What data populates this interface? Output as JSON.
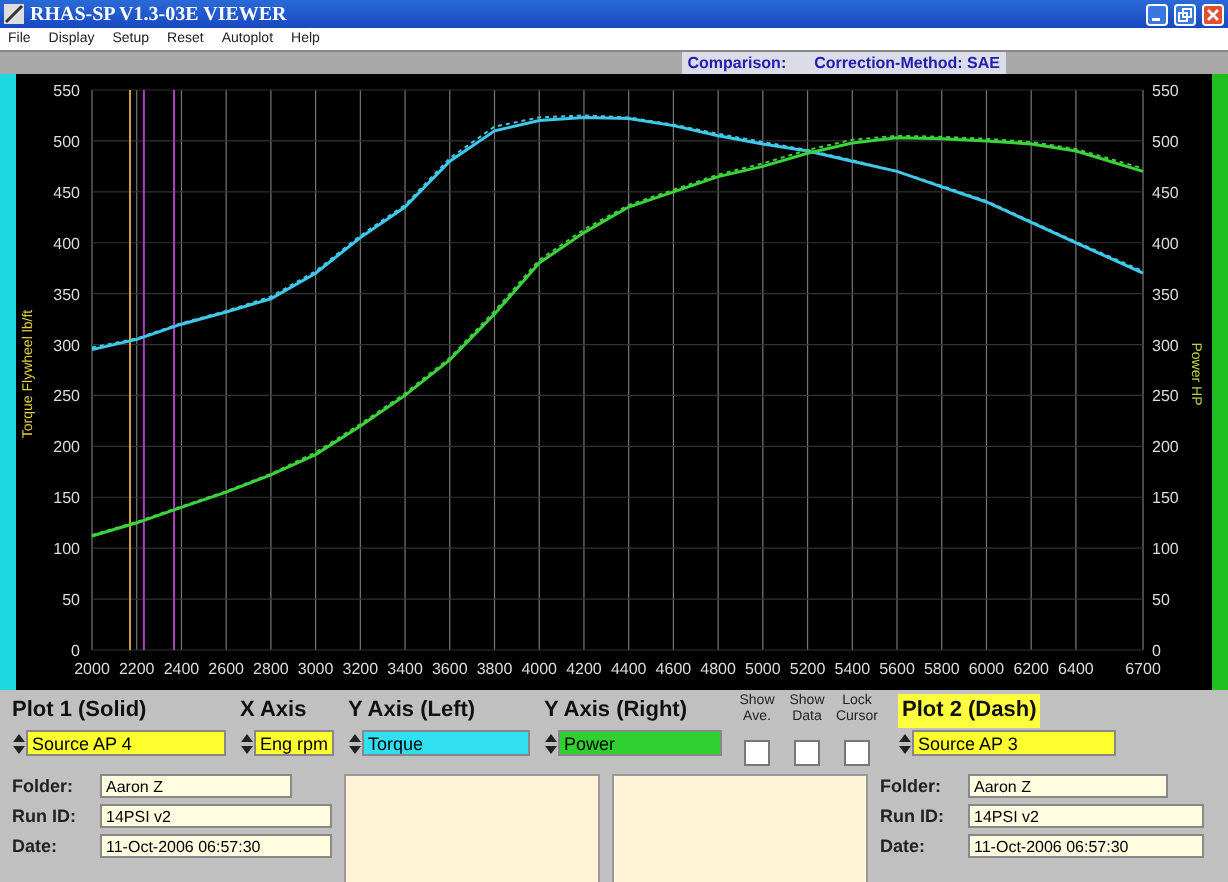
{
  "window": {
    "title": "RHAS-SP V1.3-03E VIEWER"
  },
  "menu": [
    "File",
    "Display",
    "Setup",
    "Reset",
    "Autoplot",
    "Help"
  ],
  "header": {
    "label": "Comparison:",
    "value": "Correction-Method: SAE"
  },
  "chart": {
    "left_axis": {
      "ticks": [
        "550",
        "500",
        "450",
        "400",
        "350",
        "300",
        "250",
        "200",
        "150",
        "100",
        "50",
        "0"
      ]
    },
    "right_axis": {
      "label": "Power HP"
    },
    "chart_data": {
      "type": "line",
      "ylabel": "Torque Flywheel lb/ft",
      "grid": true,
      "x": [
        2000,
        2200,
        2400,
        2600,
        2800,
        3000,
        3200,
        3400,
        3600,
        3800,
        4000,
        4200,
        4400,
        4600,
        4800,
        5000,
        5200,
        5400,
        5600,
        5800,
        6000,
        6200,
        6400,
        6700
      ],
      "series": [
        {
          "color": "#3fc8e8",
          "line_style": "solid",
          "values": [
            295,
            305,
            320,
            332,
            345,
            370,
            405,
            435,
            480,
            510,
            520,
            523,
            522,
            515,
            505,
            497,
            490,
            480,
            470,
            455,
            440,
            420,
            400,
            370
          ]
        },
        {
          "color": "#3fc8e8",
          "line_style": "dashed",
          "values": [
            297,
            306,
            321,
            333,
            347,
            372,
            407,
            437,
            483,
            514,
            523,
            525,
            523,
            516,
            507,
            499,
            491,
            481,
            470,
            456,
            441,
            421,
            401,
            372
          ]
        },
        {
          "color": "#3cd23c",
          "line_style": "solid",
          "values": [
            112,
            125,
            140,
            155,
            172,
            192,
            220,
            250,
            285,
            330,
            380,
            410,
            435,
            450,
            465,
            475,
            488,
            498,
            503,
            502,
            500,
            497,
            490,
            470
          ]
        },
        {
          "color": "#3cd23c",
          "line_style": "dashed",
          "values": [
            113,
            126,
            141,
            156,
            173,
            194,
            222,
            252,
            287,
            333,
            383,
            413,
            437,
            452,
            467,
            478,
            491,
            501,
            505,
            504,
            502,
            499,
            492,
            473
          ]
        }
      ],
      "xlim": [
        2000,
        6700
      ],
      "ylim": [
        0,
        550
      ],
      "xticks": [
        2000,
        2200,
        2400,
        2600,
        2800,
        3000,
        3200,
        3400,
        3600,
        3800,
        4000,
        4200,
        4400,
        4600,
        4800,
        5000,
        5200,
        5400,
        5600,
        5800,
        6000,
        6200,
        6400,
        6700
      ],
      "yticks": [
        0,
        50,
        100,
        150,
        200,
        250,
        300,
        350,
        400,
        450,
        500,
        550
      ],
      "ref_lines": [
        {
          "axis": "x",
          "value": 2170,
          "color": "#c8a040"
        },
        {
          "axis": "x",
          "value": 2232,
          "color": "#b040c0"
        },
        {
          "axis": "x",
          "value": 2367,
          "color": "#b040c0"
        }
      ]
    }
  },
  "controls": {
    "plot1": {
      "title": "Plot 1 (Solid)",
      "source": "Source AP 4"
    },
    "x_axis": {
      "title": "X Axis",
      "value": "Eng rpm"
    },
    "y_left": {
      "title": "Y Axis (Left)",
      "value": "Torque"
    },
    "y_right": {
      "title": "Y Axis (Right)",
      "value": "Power"
    },
    "toggles": [
      {
        "label": "Show Ave.",
        "checked": false
      },
      {
        "label": "Show Data",
        "checked": false
      },
      {
        "label": "Lock Cursor",
        "checked": false
      }
    ],
    "plot2": {
      "title": "Plot 2 (Dash)",
      "source": "Source AP 3"
    }
  },
  "run_info": [
    {
      "fields": [
        {
          "label": "Folder:",
          "value": "Aaron Z"
        },
        {
          "label": "Run ID:",
          "value": "14PSI v2"
        },
        {
          "label": "Date:",
          "value": "11-Oct-2006  06:57:30"
        }
      ]
    },
    {
      "fields": [
        {
          "label": "Folder:",
          "value": "Aaron Z"
        },
        {
          "label": "Run ID:",
          "value": "14PSI v2"
        },
        {
          "label": "Date:",
          "value": "11-Oct-2006  06:57:30"
        }
      ]
    }
  ]
}
